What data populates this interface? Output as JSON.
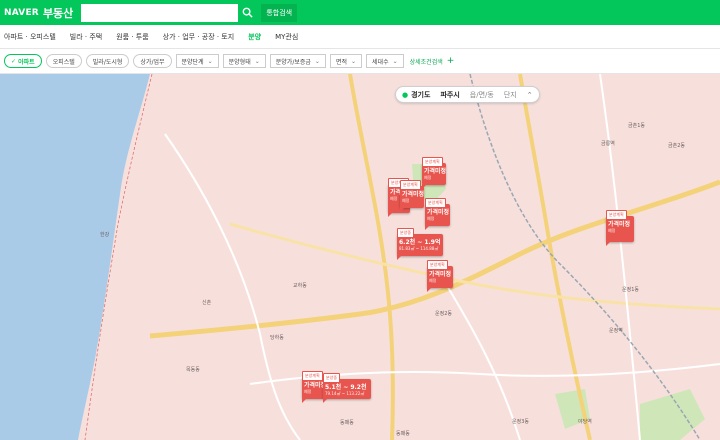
{
  "header": {
    "logo": "NAVER",
    "service": "부동산",
    "search_placeholder": "",
    "integrated_search": "통합검색"
  },
  "nav": {
    "items": [
      "아파트 · 오피스텔",
      "빌라 · 주택",
      "원룸 · 투룸",
      "상가 · 업무 · 공장 · 토지",
      "분양",
      "MY관심"
    ],
    "active_index": 4
  },
  "filters": {
    "chips": [
      "아파트",
      "오피스텔",
      "빌라/도시형",
      "상가/업무"
    ],
    "active_chip": 0,
    "dropdowns": [
      "분양단계",
      "분양형태",
      "분양가/보증금",
      "면적",
      "세대수"
    ],
    "detail_search": "상세조건검색",
    "plus": "+"
  },
  "location": {
    "province": "경기도",
    "city": "파주시",
    "district": "읍/면/동",
    "complex": "단지"
  },
  "markers": [
    {
      "tag": "분양계획",
      "price": "가격미정",
      "sub": "예정"
    },
    {
      "tag": "분양계획",
      "price": "가격미정",
      "sub": "예정"
    },
    {
      "tag": "분양계획",
      "price": "가격미정",
      "sub": "예정"
    },
    {
      "tag": "분양계획",
      "price": "가격미정",
      "sub": "예정"
    },
    {
      "tag": "분양중",
      "price": "6.2천 ~ 1.9억",
      "sub": "81.83㎡ ~ 114.88㎡"
    },
    {
      "tag": "분양계획",
      "price": "가격미정",
      "sub": "예정"
    },
    {
      "tag": "분양계획",
      "price": "가격미정",
      "sub": "예정"
    },
    {
      "tag": "분양계획",
      "price": "가격미정",
      "sub": "예정"
    },
    {
      "tag": "분양중",
      "price": "5.1천 ~ 9.2천",
      "sub": "79.14㎡ ~ 113.22㎡"
    }
  ],
  "map_labels": [
    "교하동",
    "운정2동",
    "운정1동",
    "운정3동",
    "금릉역",
    "운정역",
    "야당역",
    "금촌2동",
    "금촌1동",
    "한강",
    "신촌",
    "동패동",
    "목동동",
    "당하동",
    "동패동"
  ],
  "colors": {
    "brand": "#03c75a",
    "marker": "#e8554e",
    "river": "#a9cbe8",
    "land": "#f7e0dc",
    "road": "#f4d27a",
    "park": "#cfe6b8"
  }
}
